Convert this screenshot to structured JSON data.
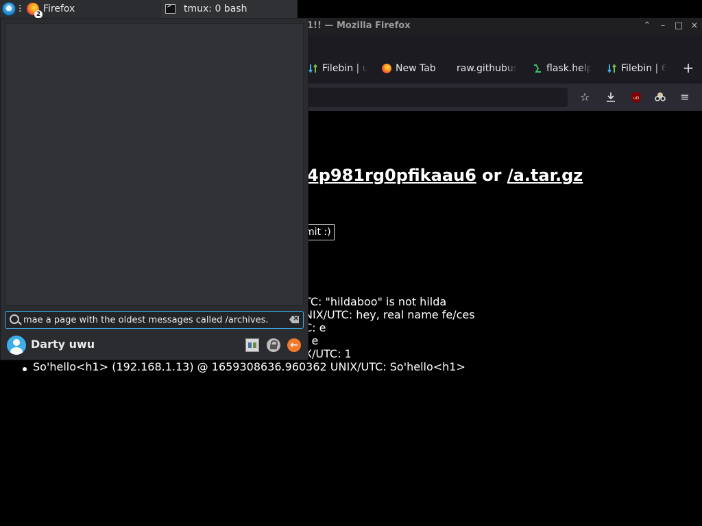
{
  "taskbar": {
    "tasks": [
      {
        "label": "Firefox",
        "badge": "2",
        "icon": "firefox-icon"
      },
      {
        "label": "tmux: 0 bash",
        "icon": "terminal-icon"
      }
    ]
  },
  "window": {
    "title": "1!! — Mozilla Firefox",
    "controls": {
      "up": "⌃",
      "minimize": "–",
      "maximize": "□",
      "close": "×"
    }
  },
  "tabs": [
    {
      "label": "Filebin | u",
      "icon": "filebin-icon"
    },
    {
      "label": "New Tab",
      "icon": "firefox-icon"
    },
    {
      "label": "raw.githubus",
      "icon": "none"
    },
    {
      "label": "flask.help",
      "icon": "flask-icon"
    },
    {
      "label": "Filebin | 6",
      "icon": "filebin-icon"
    }
  ],
  "newtab_symbol": "+",
  "page": {
    "heading_link1": "4p981rg0pfikaau6",
    "heading_or": "or",
    "heading_link2": "/a.tar.gz",
    "submit_label": "mit :)",
    "messages": [
      "TC: \"hildaboo\" is not hilda",
      "NIX/UTC: hey, real name fe/ces",
      "C: e",
      ": e",
      "X/UTC: 1",
      "So'hello<h1> (192.168.1.13) @ 1659308636.960362 UNIX/UTC: So'hello<h1>"
    ]
  },
  "runner": {
    "query": "mae a page with the oldest messages called /archives.",
    "user_name": "Darty uwu",
    "actions": [
      "switch-user",
      "lock-screen",
      "logout"
    ]
  },
  "colors": {
    "accent": "#3daee9",
    "page_bg": "#000000",
    "logout": "#f27a2a"
  }
}
